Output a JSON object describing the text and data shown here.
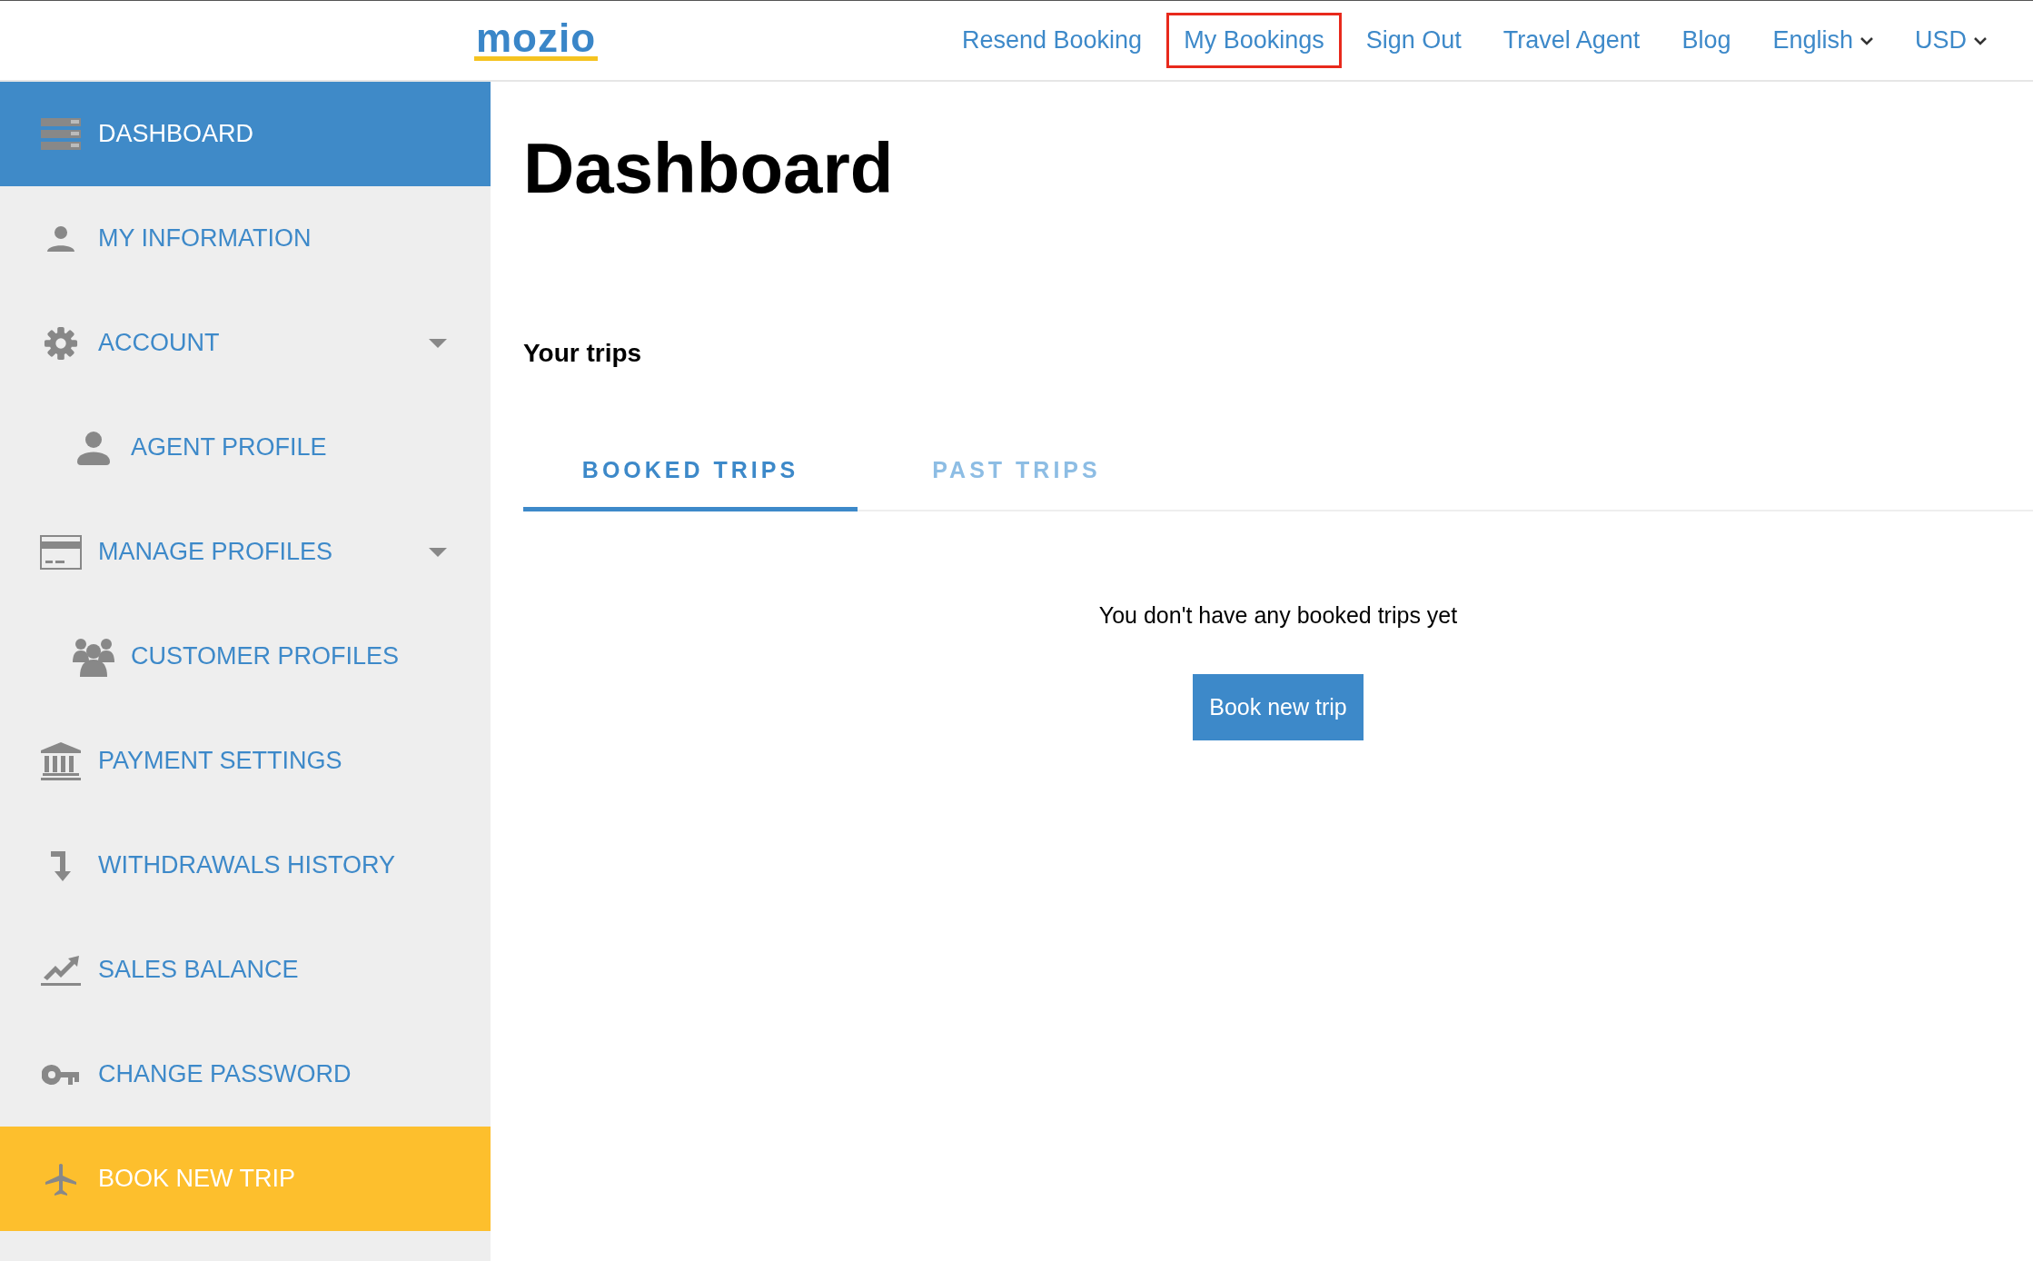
{
  "header": {
    "logo": "mozio",
    "nav": [
      {
        "label": "Resend Booking",
        "highlighted": false,
        "dropdown": false
      },
      {
        "label": "My Bookings",
        "highlighted": true,
        "dropdown": false
      },
      {
        "label": "Sign Out",
        "highlighted": false,
        "dropdown": false
      },
      {
        "label": "Travel Agent",
        "highlighted": false,
        "dropdown": false
      },
      {
        "label": "Blog",
        "highlighted": false,
        "dropdown": false
      },
      {
        "label": "English",
        "highlighted": false,
        "dropdown": true
      },
      {
        "label": "USD",
        "highlighted": false,
        "dropdown": true
      }
    ]
  },
  "sidebar": {
    "items": [
      {
        "label": "DASHBOARD",
        "kind": "link",
        "selected": true
      },
      {
        "label": "MY INFORMATION",
        "kind": "link",
        "selected": false
      },
      {
        "label": "ACCOUNT",
        "kind": "link",
        "selected": false,
        "children": [
          {
            "label": "AGENT PROFILE",
            "kind": "link",
            "selected": false
          }
        ]
      },
      {
        "label": "MANAGE PROFILES",
        "kind": "link",
        "selected": false,
        "children": [
          {
            "label": "CUSTOMER PROFILES",
            "kind": "link",
            "selected": false
          }
        ]
      },
      {
        "label": "PAYMENT SETTINGS",
        "kind": "link",
        "selected": false
      },
      {
        "label": "WITHDRAWALS HISTORY",
        "kind": "link",
        "selected": false
      },
      {
        "label": "SALES BALANCE",
        "kind": "link",
        "selected": false
      },
      {
        "label": "CHANGE PASSWORD",
        "kind": "link",
        "selected": false
      },
      {
        "label": "BOOK NEW TRIP",
        "kind": "action",
        "selected": false
      }
    ]
  },
  "main": {
    "title": "Dashboard",
    "subtitle": "Your trips",
    "tabs": [
      {
        "label": "BOOKED TRIPS",
        "selected": true
      },
      {
        "label": "PAST TRIPS",
        "selected": false
      }
    ],
    "empty_message": "You don't have any booked trips yet",
    "button": "Book new trip"
  }
}
